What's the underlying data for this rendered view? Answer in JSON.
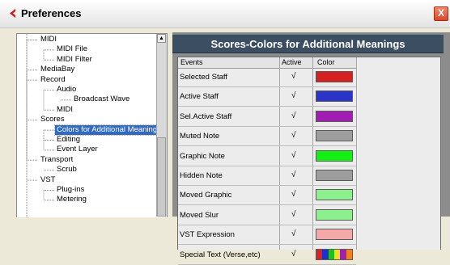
{
  "window": {
    "title": "Preferences",
    "close_label": "X"
  },
  "tree": {
    "items": [
      {
        "label": "MIDI",
        "depth": 0
      },
      {
        "label": "MIDI File",
        "depth": 1
      },
      {
        "label": "MIDI Filter",
        "depth": 1
      },
      {
        "label": "MediaBay",
        "depth": 0
      },
      {
        "label": "Record",
        "depth": 0
      },
      {
        "label": "Audio",
        "depth": 1
      },
      {
        "label": "Broadcast Wave",
        "depth": 2
      },
      {
        "label": "MIDI",
        "depth": 1
      },
      {
        "label": "Scores",
        "depth": 0
      },
      {
        "label": "Colors for Additional Meanings",
        "depth": 1,
        "selected": true
      },
      {
        "label": "Editing",
        "depth": 1
      },
      {
        "label": "Event Layer",
        "depth": 1
      },
      {
        "label": "Transport",
        "depth": 0
      },
      {
        "label": "Scrub",
        "depth": 1
      },
      {
        "label": "VST",
        "depth": 0
      },
      {
        "label": "Plug-ins",
        "depth": 1
      },
      {
        "label": "Metering",
        "depth": 1
      }
    ]
  },
  "panel": {
    "title": "Scores-Colors for Additional Meanings",
    "columns": {
      "events": "Events",
      "active": "Active",
      "color": "Color"
    },
    "rows": [
      {
        "event": "Selected Staff",
        "active": "√",
        "color": "#d42222"
      },
      {
        "event": "Active Staff",
        "active": "√",
        "color": "#2a34c8"
      },
      {
        "event": "Sel.Active Staff",
        "active": "√",
        "color": "#a01fb2"
      },
      {
        "event": "Muted Note",
        "active": "√",
        "color": "#9d9d9d"
      },
      {
        "event": "Graphic Note",
        "active": "√",
        "color": "#14f014"
      },
      {
        "event": "Hidden Note",
        "active": "√",
        "color": "#9d9d9d"
      },
      {
        "event": "Moved Graphic",
        "active": "√",
        "color": "#8cf08c"
      },
      {
        "event": "Moved Slur",
        "active": "√",
        "color": "#8cf08c"
      },
      {
        "event": "VST Expression",
        "active": "√",
        "color": "#f4a9a9"
      },
      {
        "event": "Special Text (Verse,etc)",
        "active": "√",
        "colors": [
          "#e02020",
          "#2030d0",
          "#20c020",
          "#f0e020",
          "#a020b0",
          "#f08020"
        ]
      }
    ]
  }
}
